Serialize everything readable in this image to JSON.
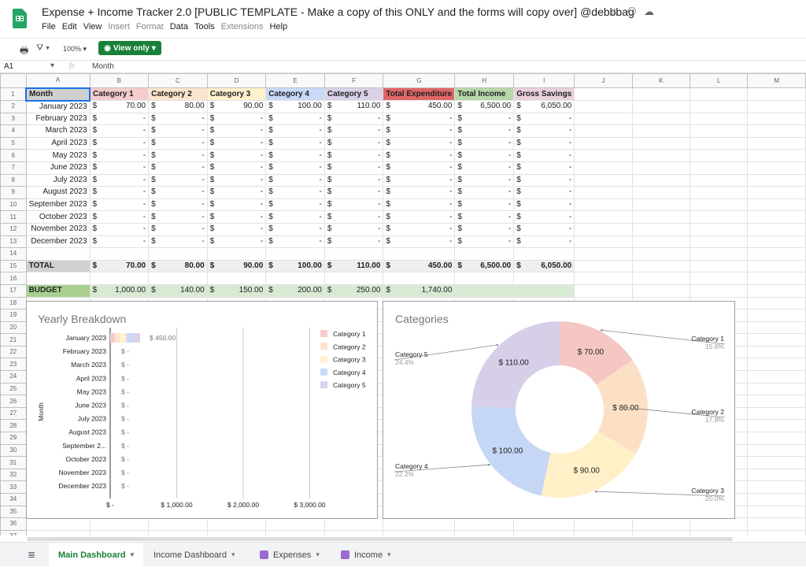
{
  "app": {
    "doc_title": "Expense + Income Tracker 2.0 [PUBLIC TEMPLATE - Make a copy of this ONLY and the forms will copy over] @debbbag",
    "title_icons": [
      "star-icon",
      "drive-move-icon",
      "cloud-status-icon"
    ],
    "menu": [
      {
        "label": "File",
        "enabled": true
      },
      {
        "label": "Edit",
        "enabled": true
      },
      {
        "label": "View",
        "enabled": true
      },
      {
        "label": "Insert",
        "enabled": false
      },
      {
        "label": "Format",
        "enabled": false
      },
      {
        "label": "Data",
        "enabled": true
      },
      {
        "label": "Tools",
        "enabled": true
      },
      {
        "label": "Extensions",
        "enabled": false
      },
      {
        "label": "Help",
        "enabled": true
      }
    ]
  },
  "toolbar": {
    "zoom": "100%",
    "view_only_label": "View only"
  },
  "formula_bar": {
    "cell_ref": "A1",
    "fx": "fx",
    "content": "Month"
  },
  "grid": {
    "columns": [
      "A",
      "B",
      "C",
      "D",
      "E",
      "F",
      "G",
      "H",
      "I",
      "J",
      "K",
      "L",
      "M"
    ],
    "headers": [
      "Month",
      "Category 1",
      "Category 2",
      "Category 3",
      "Category 4",
      "Category 5",
      "Total Expenditure",
      "Total Income",
      "Gross Savings"
    ],
    "header_colors": [
      "#d0d0d0",
      "#f4cccc",
      "#fce5cd",
      "#fff2cc",
      "#c9daf8",
      "#d9d2e9",
      "#e06666",
      "#b6d7a8",
      "#ead1dc"
    ],
    "months": [
      "January 2023",
      "February 2023",
      "March 2023",
      "April 2023",
      "May 2023",
      "June 2023",
      "July 2023",
      "August 2023",
      "September 2023",
      "October 2023",
      "November 2023",
      "December 2023"
    ],
    "values": [
      [
        "70.00",
        "80.00",
        "90.00",
        "100.00",
        "110.00",
        "450.00",
        "6,500.00",
        "6,050.00"
      ],
      [
        "-",
        "-",
        "-",
        "-",
        "-",
        "-",
        "-",
        "-"
      ],
      [
        "-",
        "-",
        "-",
        "-",
        "-",
        "-",
        "-",
        "-"
      ],
      [
        "-",
        "-",
        "-",
        "-",
        "-",
        "-",
        "-",
        "-"
      ],
      [
        "-",
        "-",
        "-",
        "-",
        "-",
        "-",
        "-",
        "-"
      ],
      [
        "-",
        "-",
        "-",
        "-",
        "-",
        "-",
        "-",
        "-"
      ],
      [
        "-",
        "-",
        "-",
        "-",
        "-",
        "-",
        "-",
        "-"
      ],
      [
        "-",
        "-",
        "-",
        "-",
        "-",
        "-",
        "-",
        "-"
      ],
      [
        "-",
        "-",
        "-",
        "-",
        "-",
        "-",
        "-",
        "-"
      ],
      [
        "-",
        "-",
        "-",
        "-",
        "-",
        "-",
        "-",
        "-"
      ],
      [
        "-",
        "-",
        "-",
        "-",
        "-",
        "-",
        "-",
        "-"
      ],
      [
        "-",
        "-",
        "-",
        "-",
        "-",
        "-",
        "-",
        "-"
      ]
    ],
    "currency": "$",
    "total_label": "TOTAL",
    "totals": [
      "70.00",
      "80.00",
      "90.00",
      "100.00",
      "110.00",
      "450.00",
      "6,500.00",
      "6,050.00"
    ],
    "budget_label": "BUDGET",
    "budget": [
      "1,000.00",
      "140.00",
      "150.00",
      "200.00",
      "250.00",
      "1,740.00"
    ],
    "row_count": 37
  },
  "chart_data": [
    {
      "type": "bar",
      "orientation": "horizontal-stacked",
      "title": "Yearly Breakdown",
      "ylabel": "Month",
      "xlabel": "",
      "categories": [
        "January 2023",
        "February 2023",
        "March 2023",
        "April 2023",
        "May 2023",
        "June 2023",
        "July 2023",
        "August 2023",
        "September 2...",
        "October 2023",
        "November 2023",
        "December 2023"
      ],
      "series": [
        {
          "name": "Category 1",
          "color": "#f4cccc",
          "values": [
            70,
            0,
            0,
            0,
            0,
            0,
            0,
            0,
            0,
            0,
            0,
            0
          ]
        },
        {
          "name": "Category 2",
          "color": "#fce5cd",
          "values": [
            80,
            0,
            0,
            0,
            0,
            0,
            0,
            0,
            0,
            0,
            0,
            0
          ]
        },
        {
          "name": "Category 3",
          "color": "#fff2cc",
          "values": [
            90,
            0,
            0,
            0,
            0,
            0,
            0,
            0,
            0,
            0,
            0,
            0
          ]
        },
        {
          "name": "Category 4",
          "color": "#c9daf8",
          "values": [
            100,
            0,
            0,
            0,
            0,
            0,
            0,
            0,
            0,
            0,
            0,
            0
          ]
        },
        {
          "name": "Category 5",
          "color": "#d9d2e9",
          "values": [
            110,
            0,
            0,
            0,
            0,
            0,
            0,
            0,
            0,
            0,
            0,
            0
          ]
        }
      ],
      "total_labels": [
        "$ 450.00",
        "$ -",
        "$ -",
        "$ -",
        "$ -",
        "$ -",
        "$ -",
        "$ -",
        "$ -",
        "$ -",
        "$ -",
        "$ -"
      ],
      "xticks": [
        0,
        1000,
        2000,
        3000
      ],
      "xtick_labels": [
        "$ -",
        "$ 1,000.00",
        "$ 2,000.00",
        "$ 3,000.00"
      ],
      "xlim": [
        0,
        3400
      ],
      "grid": true,
      "legend": "right"
    },
    {
      "type": "pie",
      "donut": true,
      "title": "Categories",
      "slices": [
        {
          "label": "Category 1",
          "value": 70,
          "value_label": "$ 70.00",
          "percent": "15.6%",
          "color": "#f4c7c3"
        },
        {
          "label": "Category 2",
          "value": 80,
          "value_label": "$ 80.00",
          "percent": "17.8%",
          "color": "#fce0c6"
        },
        {
          "label": "Category 3",
          "value": 90,
          "value_label": "$ 90.00",
          "percent": "20.0%",
          "color": "#fff0c7"
        },
        {
          "label": "Category 4",
          "value": 100,
          "value_label": "$ 100.00",
          "percent": "22.2%",
          "color": "#c6d7f6"
        },
        {
          "label": "Category 5",
          "value": 110,
          "value_label": "$ 110.00",
          "percent": "24.4%",
          "color": "#d7cfe8"
        }
      ],
      "legend": "labeled"
    }
  ],
  "sheets": [
    {
      "label": "Main Dashboard",
      "active": true,
      "form": false
    },
    {
      "label": "Income Dashboard",
      "active": false,
      "form": false
    },
    {
      "label": "Expenses",
      "active": false,
      "form": true
    },
    {
      "label": "Income",
      "active": false,
      "form": true
    }
  ]
}
